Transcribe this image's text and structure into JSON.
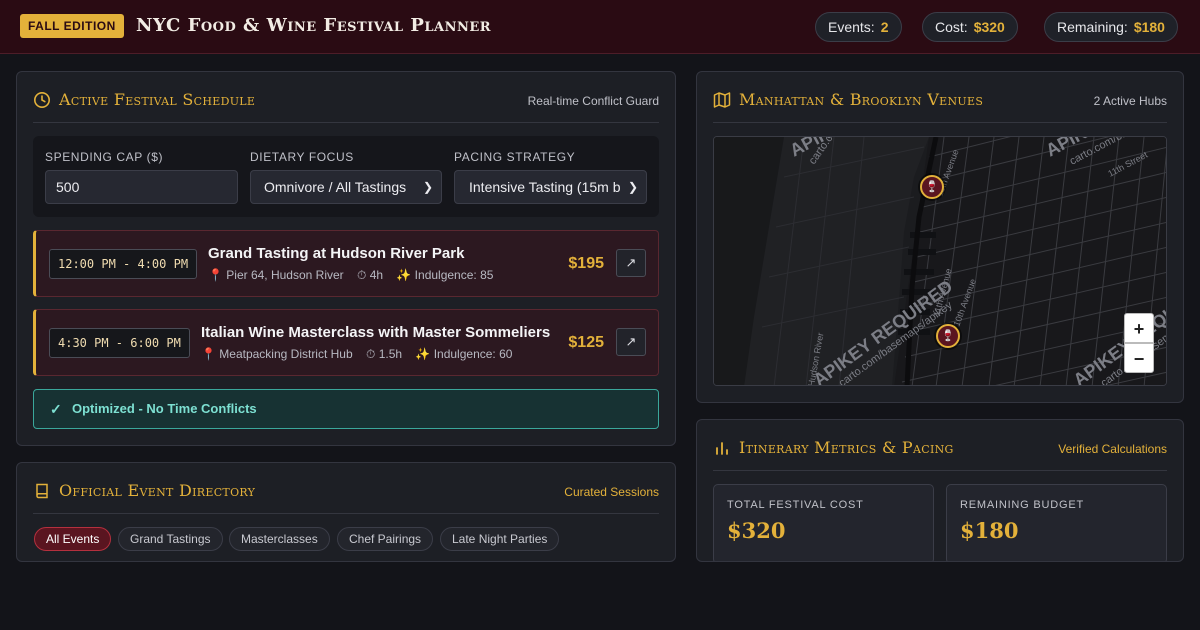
{
  "header": {
    "edition_badge": "FALL EDITION",
    "title": "NYC Food & Wine Festival Planner",
    "stats": [
      {
        "label": "Events:",
        "value": "2"
      },
      {
        "label": "Cost:",
        "value": "$320"
      },
      {
        "label": "Remaining:",
        "value": "$180"
      }
    ]
  },
  "schedule": {
    "title": "Active Festival Schedule",
    "meta": "Real-time Conflict Guard",
    "controls": {
      "spending_cap_label": "Spending Cap ($)",
      "spending_cap_value": "500",
      "dietary_label": "Dietary Focus",
      "dietary_value": "Omnivore / All Tastings",
      "pacing_label": "Pacing Strategy",
      "pacing_value": "Intensive Tasting (15m b"
    },
    "items": [
      {
        "time": "12:00 PM - 4:00 PM",
        "title": "Grand Tasting at Hudson River Park",
        "location": "📍 Pier 64, Hudson River",
        "duration": "⏱ 4h",
        "indulgence": "✨ Indulgence: 85",
        "price": "$195",
        "open_icon": "↗"
      },
      {
        "time": "4:30 PM - 6:00 PM",
        "title": "Italian Wine Masterclass with Master Sommeliers",
        "location": "📍 Meatpacking District Hub",
        "duration": "⏱ 1.5h",
        "indulgence": "✨ Indulgence: 60",
        "price": "$125",
        "open_icon": "↗"
      }
    ],
    "status": "Optimized - No Time Conflicts",
    "status_icon": "✓"
  },
  "directory": {
    "title": "Official Event Directory",
    "meta": "Curated Sessions",
    "filters": [
      "All Events",
      "Grand Tastings",
      "Masterclasses",
      "Chef Pairings",
      "Late Night Parties"
    ]
  },
  "venues": {
    "title": "Manhattan & Brooklyn Venues",
    "meta": "2 Active Hubs",
    "map_labels": [
      "APIKEY REQUIRED",
      "carto.com/basemaps/apikey",
      "11th Avenue",
      "10th Avenue",
      "Hudson River",
      "11th Street"
    ],
    "zoom_in": "+",
    "zoom_out": "−",
    "marker_icon": "🍷"
  },
  "metrics": {
    "title": "Itinerary Metrics & Pacing",
    "meta": "Verified Calculations",
    "cards": [
      {
        "label": "Total Festival Cost",
        "value": "$320"
      },
      {
        "label": "Remaining Budget",
        "value": "$180"
      }
    ]
  },
  "colors": {
    "accent_gold": "#e3b13a",
    "header_bg": "#2a0b13",
    "success": "#3aa79b",
    "panel_bg": "#1d1f25"
  }
}
